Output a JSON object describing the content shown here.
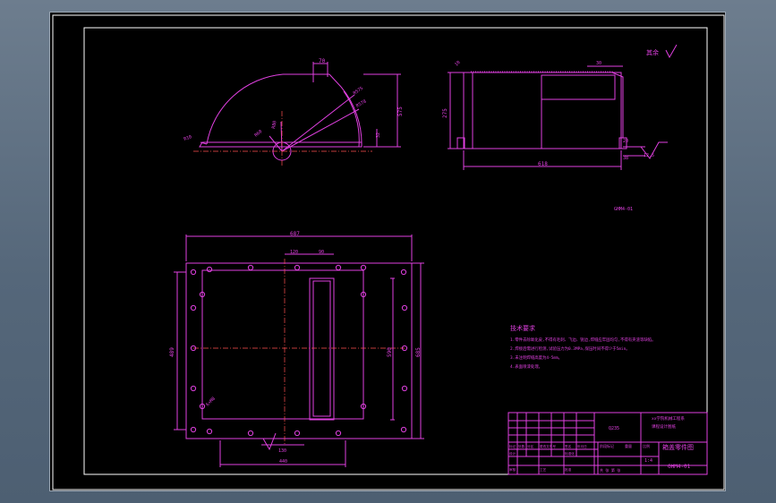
{
  "colors": {
    "background": "#000000",
    "geometry": "#e040e0",
    "text_white": "#ffffff",
    "centerline": "#ff5050",
    "window_bg": "#5d6e80"
  },
  "drawing": {
    "roughness_note": "其余",
    "roughness_symbol_value": "12.5",
    "drawing_code": "GHM4-01",
    "side_view": {
      "dims": {
        "top": "70",
        "height": "575",
        "r1": "R575",
        "r2": "R578",
        "flange": "R10",
        "small": "32",
        "d1": "R60",
        "d2": "R80"
      }
    },
    "front_view": {
      "dims": {
        "h": "275",
        "w": "618",
        "lip": "30",
        "t": "10",
        "s1": "20",
        "s2": "38",
        "s3": "30"
      }
    },
    "plan_view": {
      "dims": {
        "top": "687",
        "a": "120",
        "b": "90",
        "left": "489",
        "right1": "590",
        "right2": "685",
        "bot1": "130",
        "bot2": "440",
        "hole": "6×M8"
      }
    },
    "tech_req": {
      "title": "技术要求",
      "items": [
        "1.零件去除氧化皮,不得有毛刺、飞边、锐边,焊缝应牢固均匀,不得有夹渣等缺陷。",
        "2.焊接后需进行检测,试验压力为0.3MPa,保压时间不得少于5min。",
        "3.未注明焊缝高度为4-5mm。",
        "4.表面喷漆处理。"
      ]
    },
    "title_block": {
      "material": "Q235",
      "company": "xx学院机械工程系",
      "company2": "课程设计图纸",
      "part_name": "箱盖零件图",
      "drawing_no": "GHM4-01",
      "scale": "1:4",
      "row_labels": [
        "标记",
        "处数",
        "分区",
        "更改文件号",
        "签名",
        "年月日"
      ],
      "row_labels2": [
        "设计",
        "标准化"
      ],
      "row_labels3": [
        "审核",
        "工艺",
        "批准"
      ],
      "stage": "阶段标记",
      "weight": "重量",
      "ratio": "比例",
      "sheet": "共 张 第 张"
    }
  }
}
